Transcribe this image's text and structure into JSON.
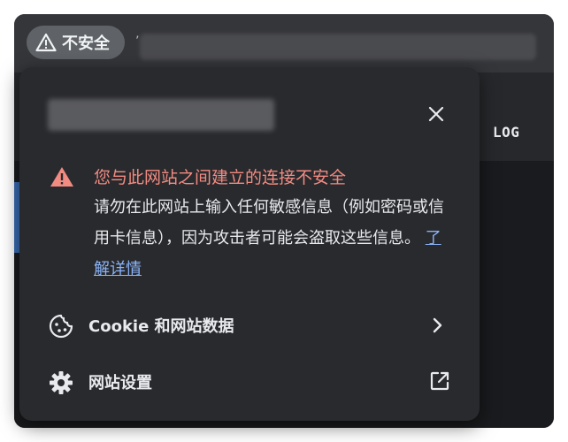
{
  "toolbar": {
    "site_chip_label": "不安全",
    "url_fragment": "’"
  },
  "page": {
    "nav_log": "LOG"
  },
  "popup": {
    "warning_title": "您与此网站之间建立的连接不安全",
    "warning_body": "请勿在此网站上输入任何敏感信息（例如密码或信用卡信息），因为攻击者可能会盗取这些信息。",
    "learn_more": "了解详情",
    "cookie_row": "Cookie 和网站数据",
    "site_settings_row": "网站设置"
  },
  "colors": {
    "warning_red": "#f28b82",
    "link_blue": "#8ab4f8",
    "popup_bg": "#292a2d",
    "text": "#e8eaed"
  },
  "icons": {
    "chip": "warning-triangle-icon",
    "close": "close-icon",
    "warning": "warning-triangle-icon",
    "cookie": "cookie-icon",
    "chevron": "chevron-right-icon",
    "gear": "gear-icon",
    "external": "open-external-icon"
  }
}
